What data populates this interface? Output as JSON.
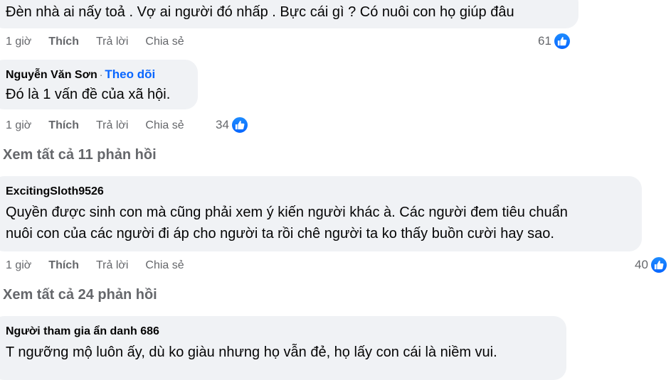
{
  "colors": {
    "bubble": "#f0f2f5",
    "link": "#0866ff",
    "secondary": "#65676b",
    "like": "#0866ff"
  },
  "icons": {
    "like": "thumbs-up-icon"
  },
  "comments": [
    {
      "author": "",
      "text": "Đèn nhà ai nấy toả . Vợ ai người đó nhấp . Bực cái gì ? Có nuôi con họ giúp đâu",
      "time": "1 giờ",
      "like_label": "Thích",
      "reply_label": "Trả lời",
      "share_label": "Chia sẻ",
      "reactions": "61"
    },
    {
      "author": "Nguyễn Văn Sơn",
      "separator": "·",
      "follow_label": "Theo dõi",
      "text": "Đó là 1 vấn đề của xã hội.",
      "time": "1 giờ",
      "like_label": "Thích",
      "reply_label": "Trả lời",
      "share_label": "Chia sẻ",
      "reactions": "34"
    },
    {
      "author": "ExcitingSloth9526",
      "text_lines": [
        "Quyền được sinh con mà cũng phải xem ý kiến người khác à. Các người đem tiêu chuẩn",
        "nuôi con của các người đi áp cho người ta rồi chê người ta ko thấy buồn cười hay sao."
      ],
      "time": "1 giờ",
      "like_label": "Thích",
      "reply_label": "Trả lời",
      "share_label": "Chia sẻ",
      "reactions": "40"
    },
    {
      "author": "Người tham gia ẩn danh 686",
      "text": "T ngưỡng mộ luôn ấy, dù ko giàu nhưng họ vẫn đẻ, họ lấy con cái là niềm vui."
    }
  ],
  "view_replies": [
    {
      "label": "Xem tất cả 11 phản hồi"
    },
    {
      "label": "Xem tất cả 24 phản hồi"
    }
  ]
}
